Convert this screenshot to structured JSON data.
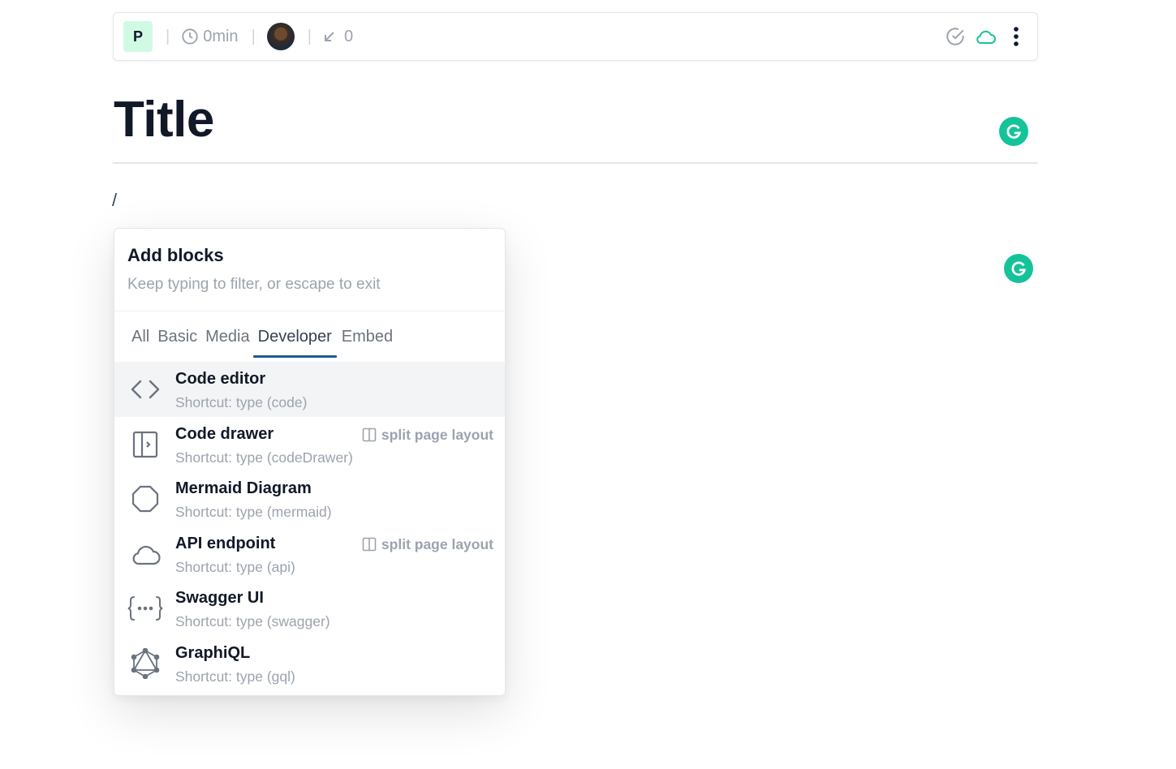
{
  "topbar": {
    "workspace_initial": "P",
    "separator": "|",
    "read_time": "0min",
    "backlinks_count": "0"
  },
  "page": {
    "title": "Title",
    "editor_input": "/"
  },
  "menu": {
    "title": "Add blocks",
    "subtitle": "Keep typing to filter, or escape to exit",
    "tabs": [
      {
        "label": "All"
      },
      {
        "label": "Basic"
      },
      {
        "label": "Media"
      },
      {
        "label": "Developer"
      },
      {
        "label": "Embed"
      }
    ],
    "active_tab": "Developer",
    "items": [
      {
        "label": "Code editor",
        "shortcut": "Shortcut: type (code)",
        "icon": "code-icon",
        "tag": ""
      },
      {
        "label": "Code drawer",
        "shortcut": "Shortcut: type (codeDrawer)",
        "icon": "code-drawer-icon",
        "tag": "split page layout"
      },
      {
        "label": "Mermaid Diagram",
        "shortcut": "Shortcut: type (mermaid)",
        "icon": "octagon-icon",
        "tag": ""
      },
      {
        "label": "API endpoint",
        "shortcut": "Shortcut: type (api)",
        "icon": "cloud-icon",
        "tag": "split page layout"
      },
      {
        "label": "Swagger UI",
        "shortcut": "Shortcut: type (swagger)",
        "icon": "braces-icon",
        "tag": ""
      },
      {
        "label": "GraphiQL",
        "shortcut": "Shortcut: type (gql)",
        "icon": "graphql-icon",
        "tag": ""
      }
    ]
  },
  "colors": {
    "accent_green": "#15c39a",
    "tab_underline": "#1e5a94",
    "workspace_badge_bg": "#d1fae5"
  }
}
